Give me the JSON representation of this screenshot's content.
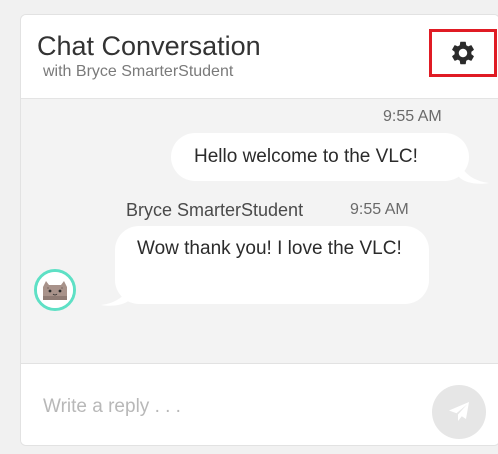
{
  "header": {
    "title": "Chat Conversation",
    "subtitle": "with Bryce SmarterStudent",
    "settings_icon": "gear-icon",
    "highlight_color": "#e01b24"
  },
  "messages": {
    "outgoing": {
      "time": "9:55 AM",
      "text": "Hello welcome to the VLC!"
    },
    "incoming": {
      "sender": "Bryce SmarterStudent",
      "time": "9:55 AM",
      "text": "Wow thank you! I love the VLC!",
      "avatar_icon": "cat-avatar",
      "avatar_ring_color": "#5ee0c5"
    }
  },
  "composer": {
    "placeholder": "Write a reply . . .",
    "value": "",
    "send_icon": "paper-plane-icon"
  }
}
